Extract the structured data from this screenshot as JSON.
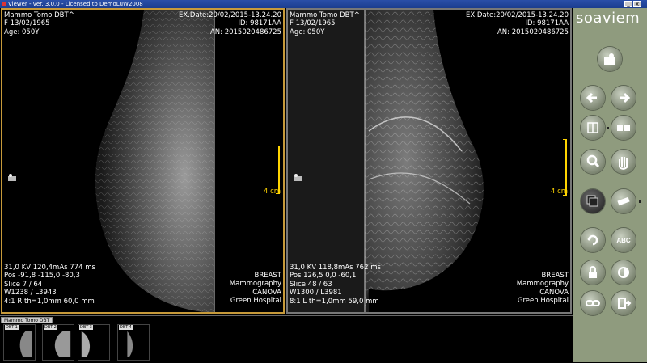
{
  "window": {
    "title": "Viewer - ver. 3.0.0 - Licensed to DemoLuW2008"
  },
  "brand": {
    "logo_text": "soaviem"
  },
  "viewports": [
    {
      "top_left": [
        "Mammo Tomo DBT^",
        "F 13/02/1965",
        "Age: 050Y"
      ],
      "top_right": [
        "EX.Date:20/02/2015-13.24.20",
        "ID: 98171AA",
        "AN: 2015020486725"
      ],
      "bottom_left": [
        "31,0 KV 120,4mAs 774 ms",
        "Pos -91,8 -115,0 -80,3",
        "Slice 7 / 64",
        "W1238 / L3943",
        "4:1 R th=1,0mm 60,0 mm"
      ],
      "bottom_right": [
        "BREAST",
        "Mammography",
        "CANOVA",
        "Green Hospital"
      ],
      "scale_label": "4 cm",
      "active": true
    },
    {
      "top_left": [
        "Mammo Tomo DBT^",
        "F 13/02/1965",
        "Age: 050Y"
      ],
      "top_right": [
        "EX.Date:20/02/2015-13.24.20",
        "ID: 98171AA",
        "AN: 2015020486725"
      ],
      "bottom_left": [
        "31,0 KV 118,8mAs 762 ms",
        "Pos 126,5 0,0 -60,1",
        "Slice 48 / 63",
        "W1300 / L3981",
        "8:1 L th=1,0mm 59,0 mm"
      ],
      "bottom_right": [
        "BREAST",
        "Mammography",
        "CANOVA",
        "Green Hospital"
      ],
      "scale_label": "4 cm",
      "active": false
    }
  ],
  "toolbar": {
    "buttons": [
      {
        "name": "open-study",
        "icon": "folder-user-icon"
      },
      {
        "name": "previous",
        "icon": "arrow-left-icon"
      },
      {
        "name": "next",
        "icon": "arrow-right-icon"
      },
      {
        "name": "layout",
        "icon": "layout-icon"
      },
      {
        "name": "series-layout",
        "icon": "series-layout-icon"
      },
      {
        "name": "zoom",
        "icon": "magnifier-icon"
      },
      {
        "name": "pan",
        "icon": "hand-icon"
      },
      {
        "name": "stack",
        "icon": "stack-icon"
      },
      {
        "name": "measure",
        "icon": "ruler-icon"
      },
      {
        "name": "rotate",
        "icon": "rotate-icon"
      },
      {
        "name": "annotate",
        "icon": "abc-text-icon"
      },
      {
        "name": "lock",
        "icon": "lock-icon"
      },
      {
        "name": "window-level",
        "icon": "contrast-icon"
      },
      {
        "name": "link",
        "icon": "link-icon"
      },
      {
        "name": "exit",
        "icon": "exit-icon"
      }
    ]
  },
  "strip": {
    "tab_label": "Mammo Tomo DBT",
    "thumbnails": [
      "DBT-1",
      "DBT-2",
      "DBT-3",
      "DBT-4"
    ]
  }
}
